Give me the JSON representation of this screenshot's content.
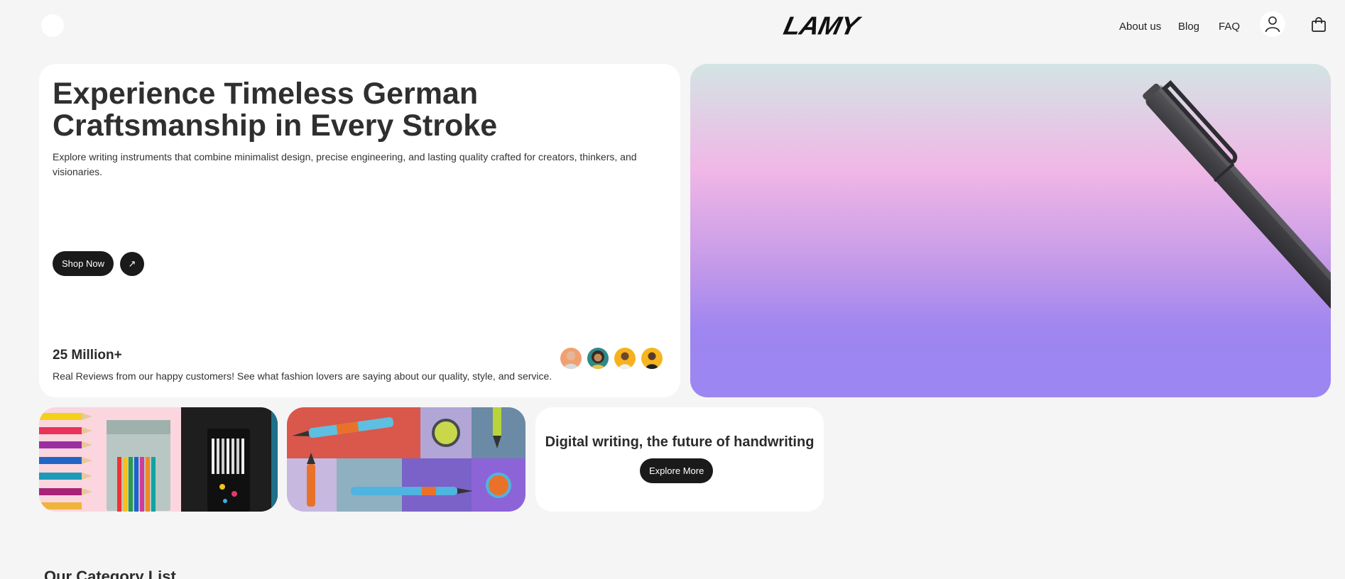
{
  "header": {
    "logo": "LAMY",
    "nav": [
      {
        "label": "About us"
      },
      {
        "label": "Blog"
      },
      {
        "label": "FAQ"
      }
    ]
  },
  "hero": {
    "title": "Experience Timeless German Craftsmanship in Every Stroke",
    "description": "Explore writing instruments that combine minimalist design, precise engineering, and lasting quality crafted for creators, thinkers, and visionaries.",
    "shop_button": "Shop Now",
    "arrow_glyph": "↗",
    "stat_number": "25 Million+",
    "stat_text": "Real Reviews from our happy customers! See what fashion lovers are saying about our quality, style, and service."
  },
  "promo": {
    "digital_title": "Digital writing, the future of handwriting",
    "explore_button": "Explore More"
  },
  "section": {
    "category_title": "Our Category List"
  },
  "colors": {
    "background": "#f5f5f5",
    "card": "#ffffff",
    "button": "#1a1a1a",
    "hero_gradient_top": "#d3e4e4",
    "hero_gradient_mid": "#f0b7e6",
    "hero_gradient_bottom": "#9b86f2"
  },
  "icons": {
    "menu": "menu-dot-icon",
    "user": "user-icon",
    "cart": "shopping-bag-icon",
    "arrow": "arrow-up-right-icon"
  }
}
